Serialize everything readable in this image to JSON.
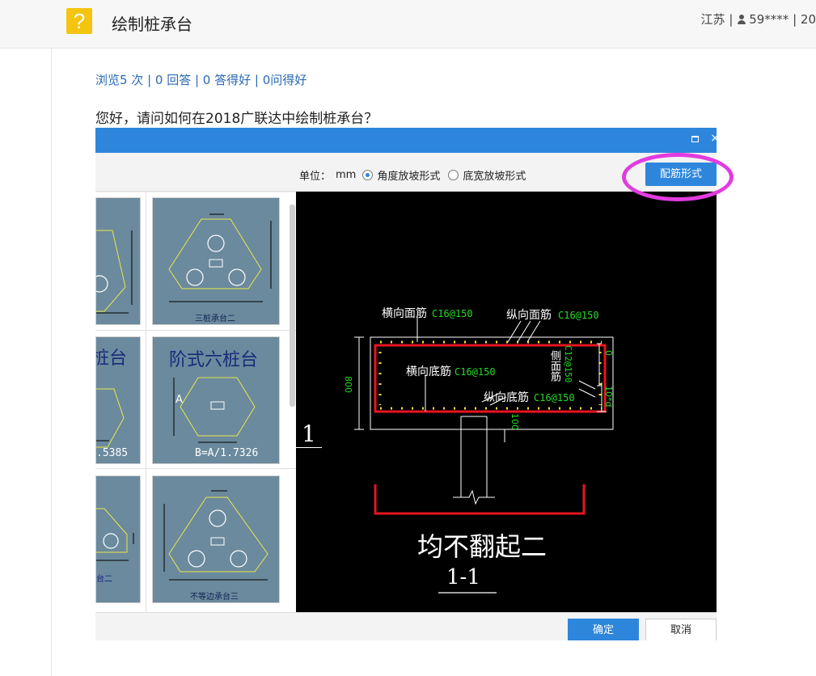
{
  "header": {
    "badge_glyph": "?",
    "title": "绘制桩承台",
    "location": "江苏",
    "separator": "|",
    "user": "59****",
    "extra": "20"
  },
  "stats": {
    "text": "浏览5 次 | 0 回答 | 0 答得好 | 0问得好"
  },
  "question": {
    "text": "您好，请问如何在2018广联达中绘制桩承台？"
  },
  "dialog": {
    "toolbar": {
      "unit_label": "单位：",
      "unit_value": "mm",
      "option_angle": "角度放坡形式",
      "option_width": "底宽放坡形式",
      "selected": "角度放坡形式",
      "rebar_button": "配筋形式"
    },
    "thumbnails": {
      "t1_caption": "三桩承台二",
      "t2_partial_title": "桩台",
      "t2_partial_formula": ".5385",
      "t3_title": "阶式六桩台",
      "t3_formula": "B=A/1.7326",
      "t3_side_label": "A",
      "t4_partial_caption": "台二",
      "t5_caption": "不等边承台三"
    },
    "cad": {
      "label_top_transverse": "横向面筋",
      "value_top_transverse": "C16@150",
      "label_top_longitudinal": "纵向面筋",
      "value_top_longitudinal": "C16@150",
      "label_bottom_transverse": "横向底筋",
      "value_bottom_transverse": "C16@150",
      "label_bottom_longitudinal": "纵向底筋",
      "value_bottom_longitudinal": "C16@150",
      "label_side": "侧面筋",
      "value_side": "C12@150",
      "dim_height": "800",
      "dim_zero": "0",
      "dim_anchor": "10*d",
      "dim_cover": "100",
      "caption_main": "均不翻起二",
      "caption_section": "1-1"
    },
    "overlay_section_mark": "1",
    "footer": {
      "ok": "确定",
      "cancel": "取消"
    }
  },
  "colors": {
    "accent_blue": "#2d86dc",
    "highlight_ring": "#e23be0",
    "badge_yellow": "#f5c40f",
    "cad_red": "#e8141e",
    "cad_green": "#22dd22",
    "cad_yellow": "#ffdd33",
    "thumb_bg": "#6b8a9d"
  }
}
